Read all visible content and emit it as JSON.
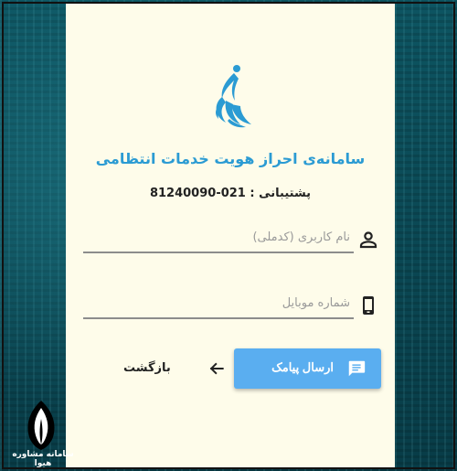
{
  "header": {
    "title": "سامانه‌ی احراز هویت خدمات انتظامی",
    "support": "پشتیبانی : 021-81240090"
  },
  "form": {
    "username_placeholder": "نام کاربری (کدملی)",
    "username_value": "",
    "username_icon": "person-icon",
    "mobile_placeholder": "شماره موبایل",
    "mobile_value": "",
    "mobile_icon": "smartphone-icon"
  },
  "actions": {
    "send_sms_label": "ارسال پیامک",
    "send_sms_icon": "message-icon",
    "back_label": "بازگشت",
    "back_icon": "arrow-left-icon"
  },
  "watermark": {
    "text": "سامانه مشاوره هیوا"
  },
  "colors": {
    "accent": "#2b9bd3",
    "button": "#5aaef0",
    "card_bg": "#fefcea",
    "page_bg": "#0b4a57"
  }
}
